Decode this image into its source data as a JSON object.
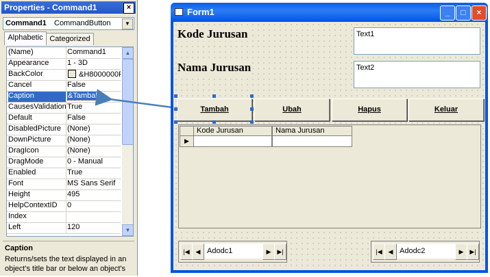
{
  "properties": {
    "title": "Properties - Command1",
    "close_icon": "×",
    "object_name": "Command1",
    "object_type": "CommandButton",
    "tabs": [
      "Alphabetic",
      "Categorized"
    ],
    "rows": [
      {
        "key": "(Name)",
        "value": "Command1"
      },
      {
        "key": "Appearance",
        "value": "1 - 3D"
      },
      {
        "key": "BackColor",
        "value": "&H8000000F"
      },
      {
        "key": "Cancel",
        "value": "False"
      },
      {
        "key": "Caption",
        "value": "&Tambah"
      },
      {
        "key": "CausesValidation",
        "value": "True"
      },
      {
        "key": "Default",
        "value": "False"
      },
      {
        "key": "DisabledPicture",
        "value": "(None)"
      },
      {
        "key": "DownPicture",
        "value": "(None)"
      },
      {
        "key": "DragIcon",
        "value": "(None)"
      },
      {
        "key": "DragMode",
        "value": "0 - Manual"
      },
      {
        "key": "Enabled",
        "value": "True"
      },
      {
        "key": "Font",
        "value": "MS Sans Serif"
      },
      {
        "key": "Height",
        "value": "495"
      },
      {
        "key": "HelpContextID",
        "value": "0"
      },
      {
        "key": "Index",
        "value": ""
      },
      {
        "key": "Left",
        "value": "120"
      }
    ],
    "selected_row": "Caption",
    "description_title": "Caption",
    "description_text": "Returns/sets the text displayed in an object's title bar or below an object's"
  },
  "form": {
    "title": "Form1",
    "label_kode": "Kode Jurusan",
    "label_nama": "Nama Jurusan",
    "text1": "Text1",
    "text2": "Text2",
    "buttons": [
      "Tambah",
      "Ubah",
      "Hapus",
      "Keluar"
    ],
    "grid_columns": [
      "Kode Jurusan",
      "Nama Jurusan"
    ],
    "adodc1": "Adodc1",
    "adodc2": "Adodc2"
  },
  "colors": {
    "selection": "#316ac5",
    "arrow": "#4a7ebb"
  }
}
